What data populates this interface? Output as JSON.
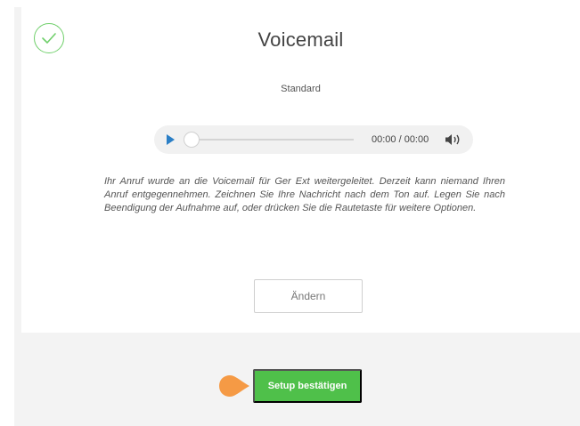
{
  "header": {
    "title": "Voicemail",
    "subtitle": "Standard",
    "status_icon": "check-circle-icon"
  },
  "player": {
    "play_icon": "play-icon",
    "time": "00:00 / 00:00",
    "progress": 0,
    "volume_icon": "volume-icon"
  },
  "message": "Ihr Anruf wurde an die Voicemail für Ger Ext weitergeleitet. Derzeit kann niemand Ihren Anruf entgegennehmen. Zeichnen Sie Ihre Nachricht nach dem Ton auf. Legen Sie nach Beendigung der Aufnahme auf, oder drücken Sie die Rautetaste für weitere Optionen.",
  "actions": {
    "change_label": "Ändern",
    "confirm_label": "Setup bestätigen"
  },
  "colors": {
    "accent_green": "#4fc04a",
    "play_blue": "#2b7fc6",
    "pin_orange": "#f59a45"
  }
}
